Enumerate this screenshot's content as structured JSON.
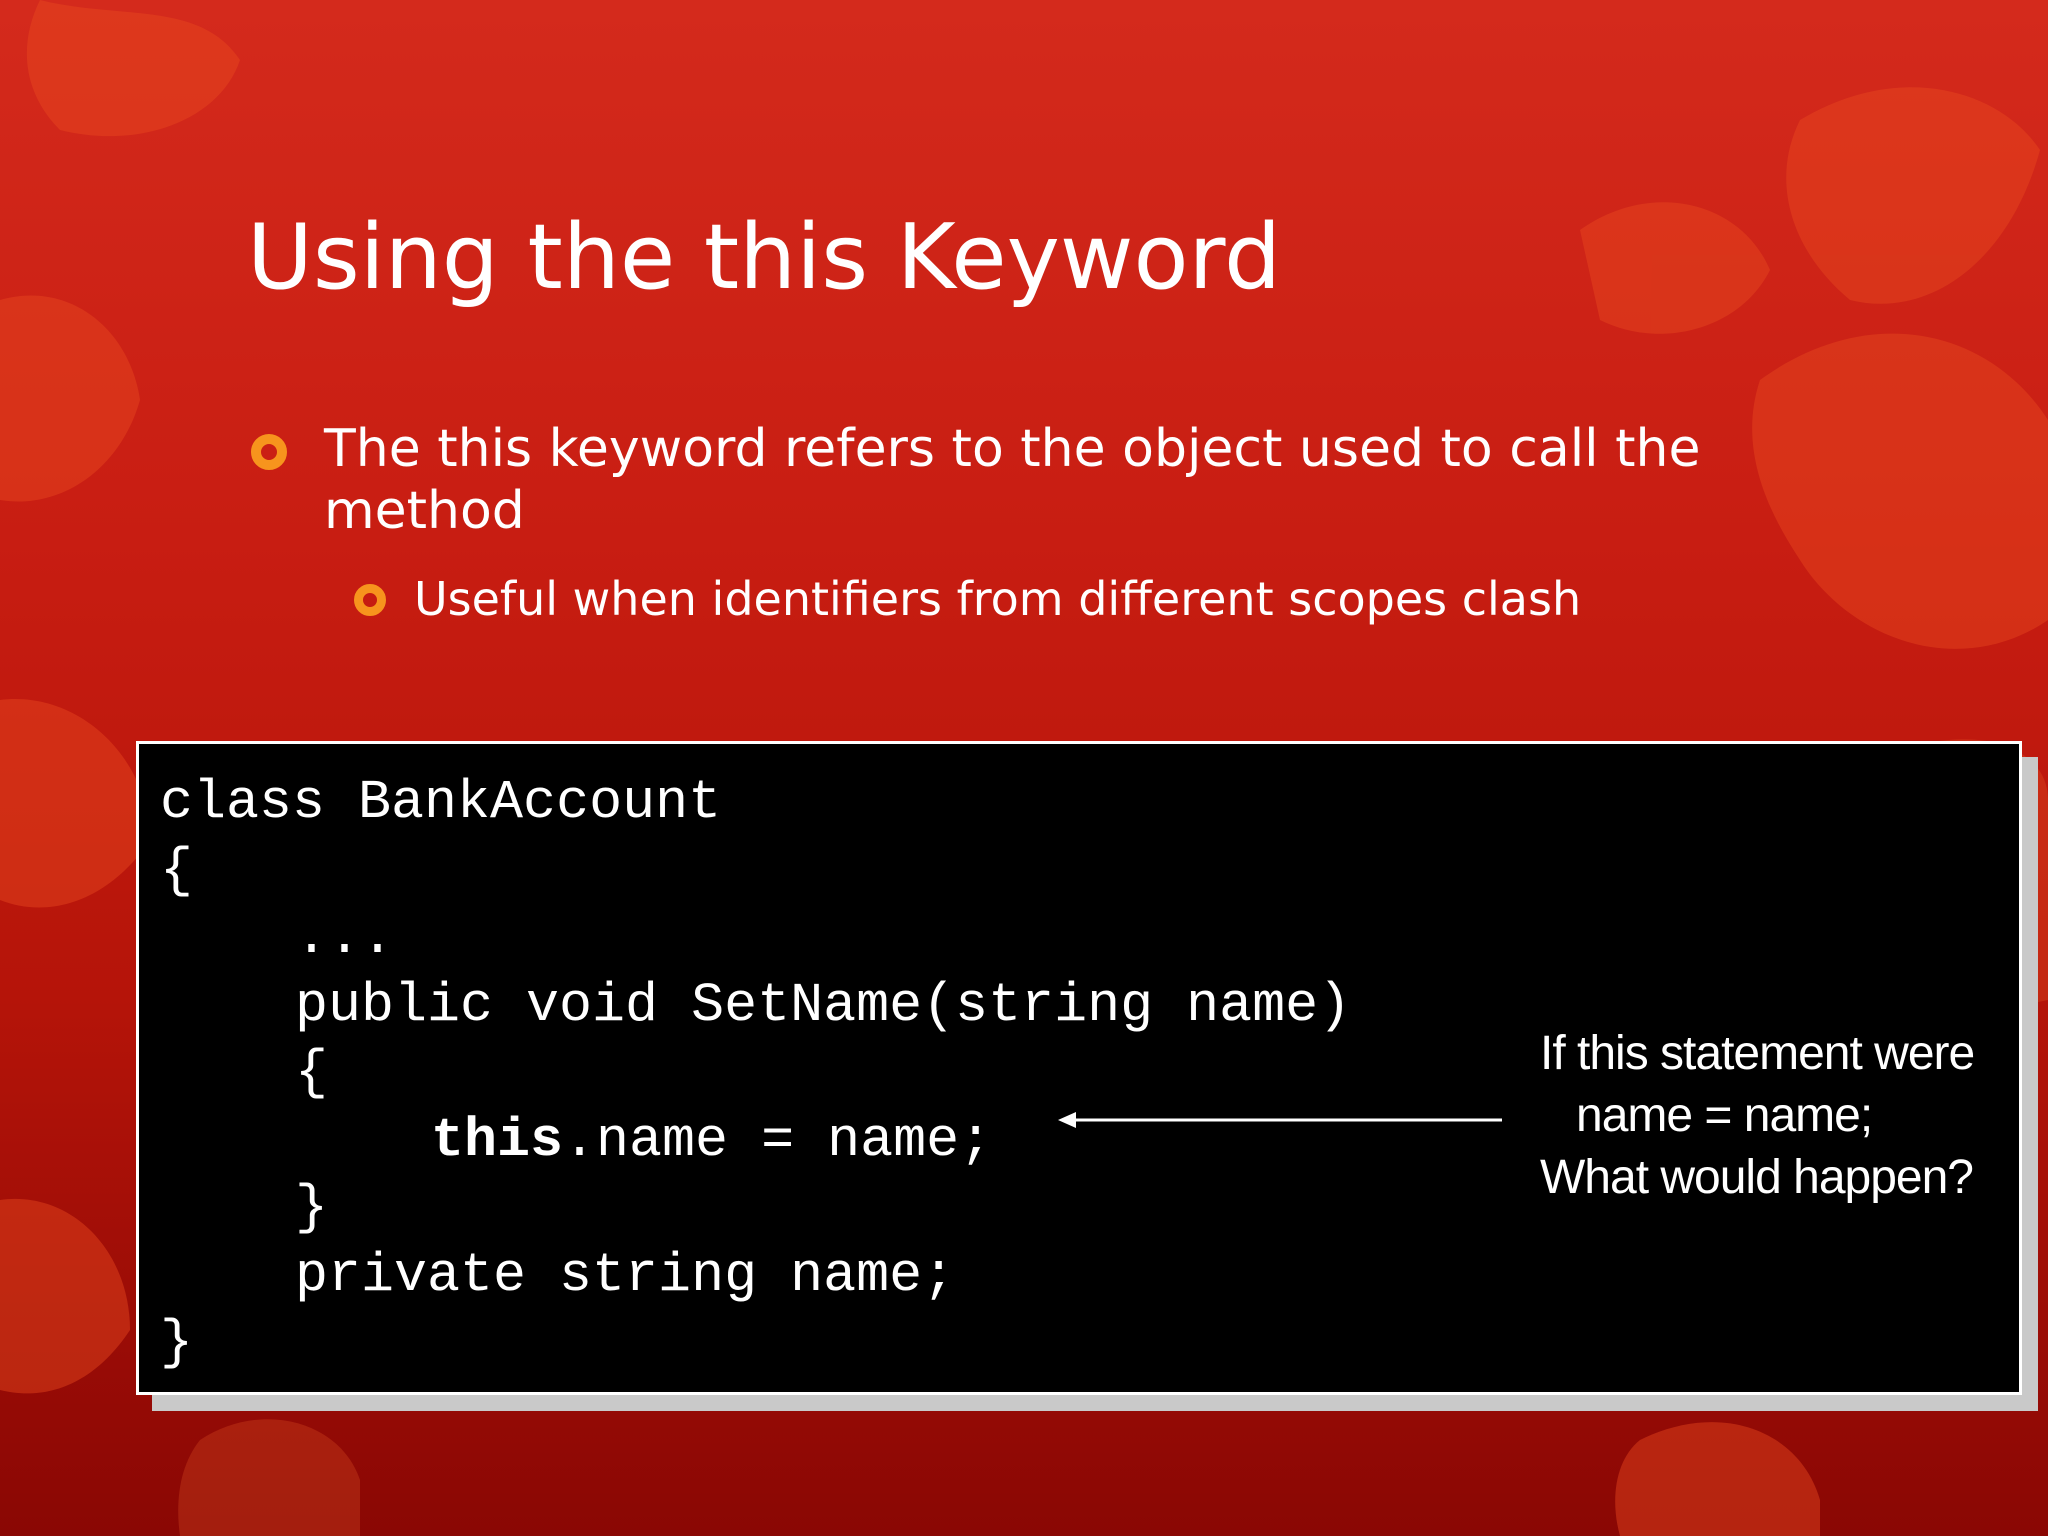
{
  "slide": {
    "title": "Using the this Keyword",
    "bullets": [
      {
        "text": "The this keyword refers to the object used to call the method",
        "sub": "Useful when identifiers from different scopes clash"
      }
    ]
  },
  "code": {
    "lines": [
      "class BankAccount",
      "{",
      "...",
      "public void SetName(string name)",
      "{",
      "this",
      ".name = name;",
      "}",
      "private string name;",
      "}"
    ]
  },
  "callout": {
    "lines": [
      "If this statement were",
      "name = name;",
      "What would happen?"
    ]
  },
  "colors": {
    "background": "#c81d12",
    "bullet_accent": "#f7941d",
    "code_background": "#000000",
    "text": "#ffffff"
  }
}
